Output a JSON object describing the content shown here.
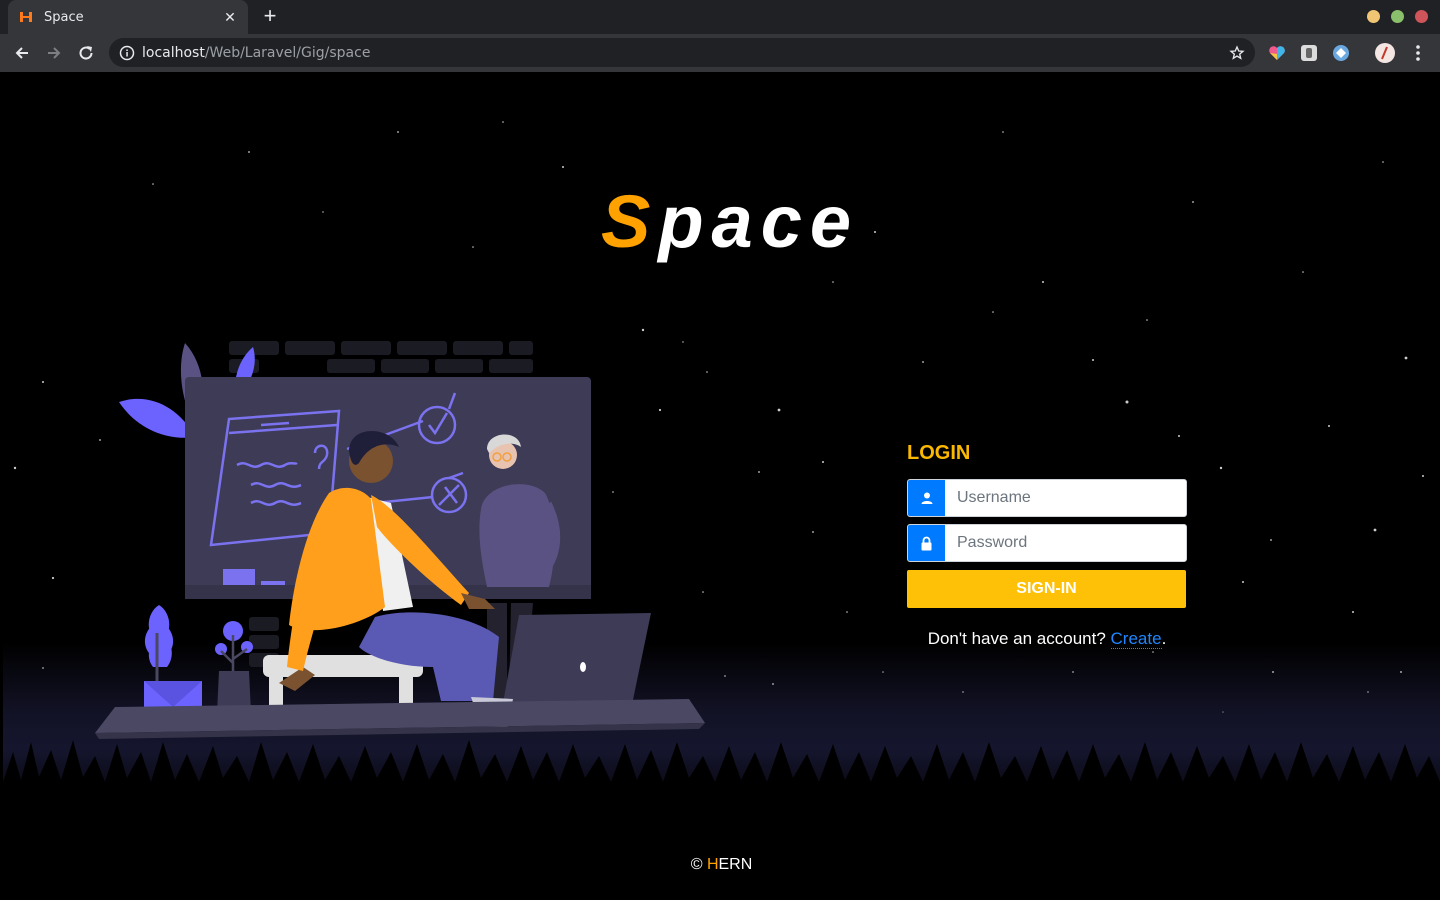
{
  "browser": {
    "tab_title": "Space",
    "tab_close": "✕",
    "new_tab": "+",
    "url_host": "localhost",
    "url_path": "/Web/Laravel/Gig/space",
    "window_colors": [
      "#f0c674",
      "#8abf6b",
      "#d0555a"
    ]
  },
  "brand": {
    "first_letter": "S",
    "rest": "pace",
    "accent": "#ffa200"
  },
  "login": {
    "title": "LOGIN",
    "username_placeholder": "Username",
    "password_placeholder": "Password",
    "submit_label": "SIGN-IN",
    "signup_prompt": "Don't have an account? ",
    "signup_link": "Create",
    "signup_end": "."
  },
  "footer": {
    "copyright": "© ",
    "accent": "H",
    "rest": "ERN"
  },
  "icons": {
    "user": "user-icon",
    "lock": "lock-icon"
  }
}
